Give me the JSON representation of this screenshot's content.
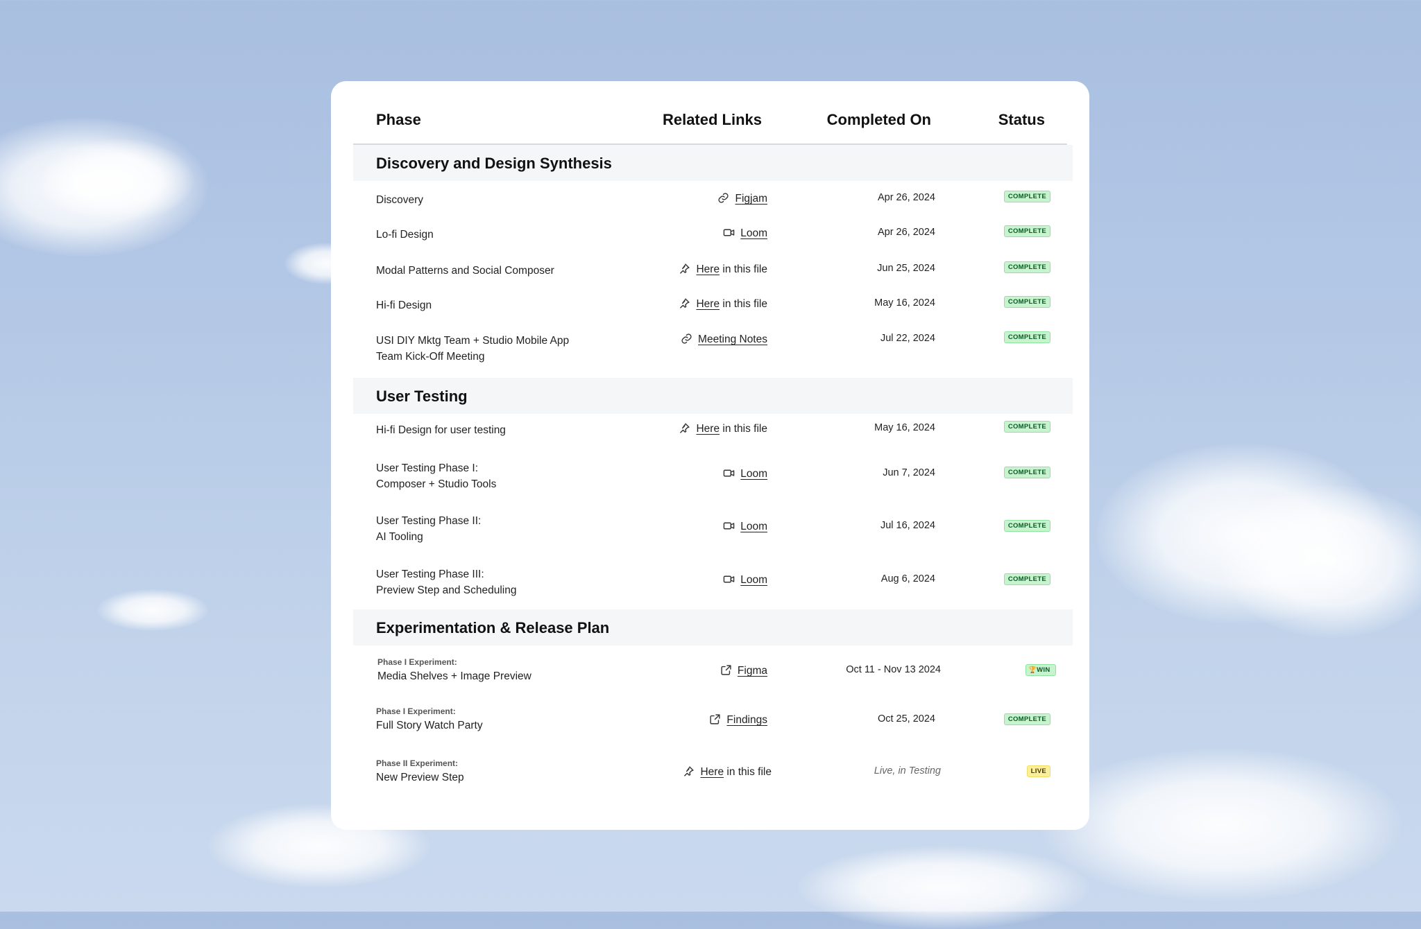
{
  "table": {
    "headers": {
      "phase": "Phase",
      "links": "Related Links",
      "completed": "Completed On",
      "status": "Status"
    },
    "sections": [
      {
        "title": "Discovery and Design Synthesis",
        "rows": [
          {
            "phase": "Discovery",
            "icon": "link-icon",
            "link": "Figjam",
            "link_suffix": "",
            "date": "Apr 26, 2024",
            "status": "COMPLETE"
          },
          {
            "phase": "Lo-fi Design",
            "icon": "video-icon",
            "link": "Loom",
            "link_suffix": "",
            "date": "Apr 26, 2024",
            "status": "COMPLETE"
          },
          {
            "phase": "Modal Patterns and Social Composer",
            "icon": "pin-icon",
            "link": "Here",
            "link_suffix": " in this file",
            "date": "Jun 25, 2024",
            "status": "COMPLETE"
          },
          {
            "phase": "Hi-fi Design",
            "icon": "pin-icon",
            "link": "Here",
            "link_suffix": " in this file",
            "date": "May 16, 2024",
            "status": "COMPLETE"
          },
          {
            "phase_line1": "USI DIY Mktg Team + Studio Mobile App",
            "phase_line2": "Team Kick-Off Meeting",
            "icon": "link-icon",
            "link": "Meeting Notes",
            "link_suffix": "",
            "date": "Jul 22, 2024",
            "status": "COMPLETE"
          }
        ]
      },
      {
        "title": "User Testing",
        "rows": [
          {
            "phase": "Hi-fi Design for user testing",
            "icon": "pin-icon",
            "link": "Here",
            "link_suffix": " in this file",
            "date": "May 16, 2024",
            "status": "COMPLETE"
          },
          {
            "phase_line1": "User Testing Phase I:",
            "phase_line2": "Composer + Studio Tools",
            "icon": "video-icon",
            "link": "Loom",
            "link_suffix": "",
            "date": "Jun 7, 2024",
            "status": "COMPLETE"
          },
          {
            "phase_line1": "User Testing Phase II:",
            "phase_line2": "AI Tooling",
            "icon": "video-icon",
            "link": "Loom",
            "link_suffix": "",
            "date": "Jul 16, 2024",
            "status": "COMPLETE"
          },
          {
            "phase_line1": "User Testing Phase III:",
            "phase_line2": "Preview Step and Scheduling",
            "icon": "video-icon",
            "link": "Loom",
            "link_suffix": "",
            "date": "Aug 6, 2024",
            "status": "COMPLETE"
          }
        ]
      },
      {
        "title": "Experimentation & Release Plan",
        "rows": [
          {
            "pre": "Phase I Experiment:",
            "phase": "Media Shelves + Image Preview",
            "icon": "external-link-icon",
            "link": "Figma",
            "link_suffix": "",
            "date": "Oct 11 - Nov 13 2024",
            "status": "🏆WIN"
          },
          {
            "pre": "Phase I Experiment:",
            "phase": "Full Story Watch Party",
            "icon": "external-link-icon",
            "link": "Findings",
            "link_suffix": "",
            "date": "Oct 25, 2024",
            "status": "COMPLETE"
          },
          {
            "pre": "Phase II Experiment:",
            "phase": "New Preview Step",
            "icon": "pin-icon",
            "link": "Here",
            "link_suffix": " in this file",
            "date": "Live, in Testing",
            "status": "LIVE"
          }
        ]
      }
    ]
  },
  "colors": {
    "complete_bg": "#c7f3cf",
    "live_bg": "#fbef9b",
    "section_bg": "#f5f6f7"
  }
}
